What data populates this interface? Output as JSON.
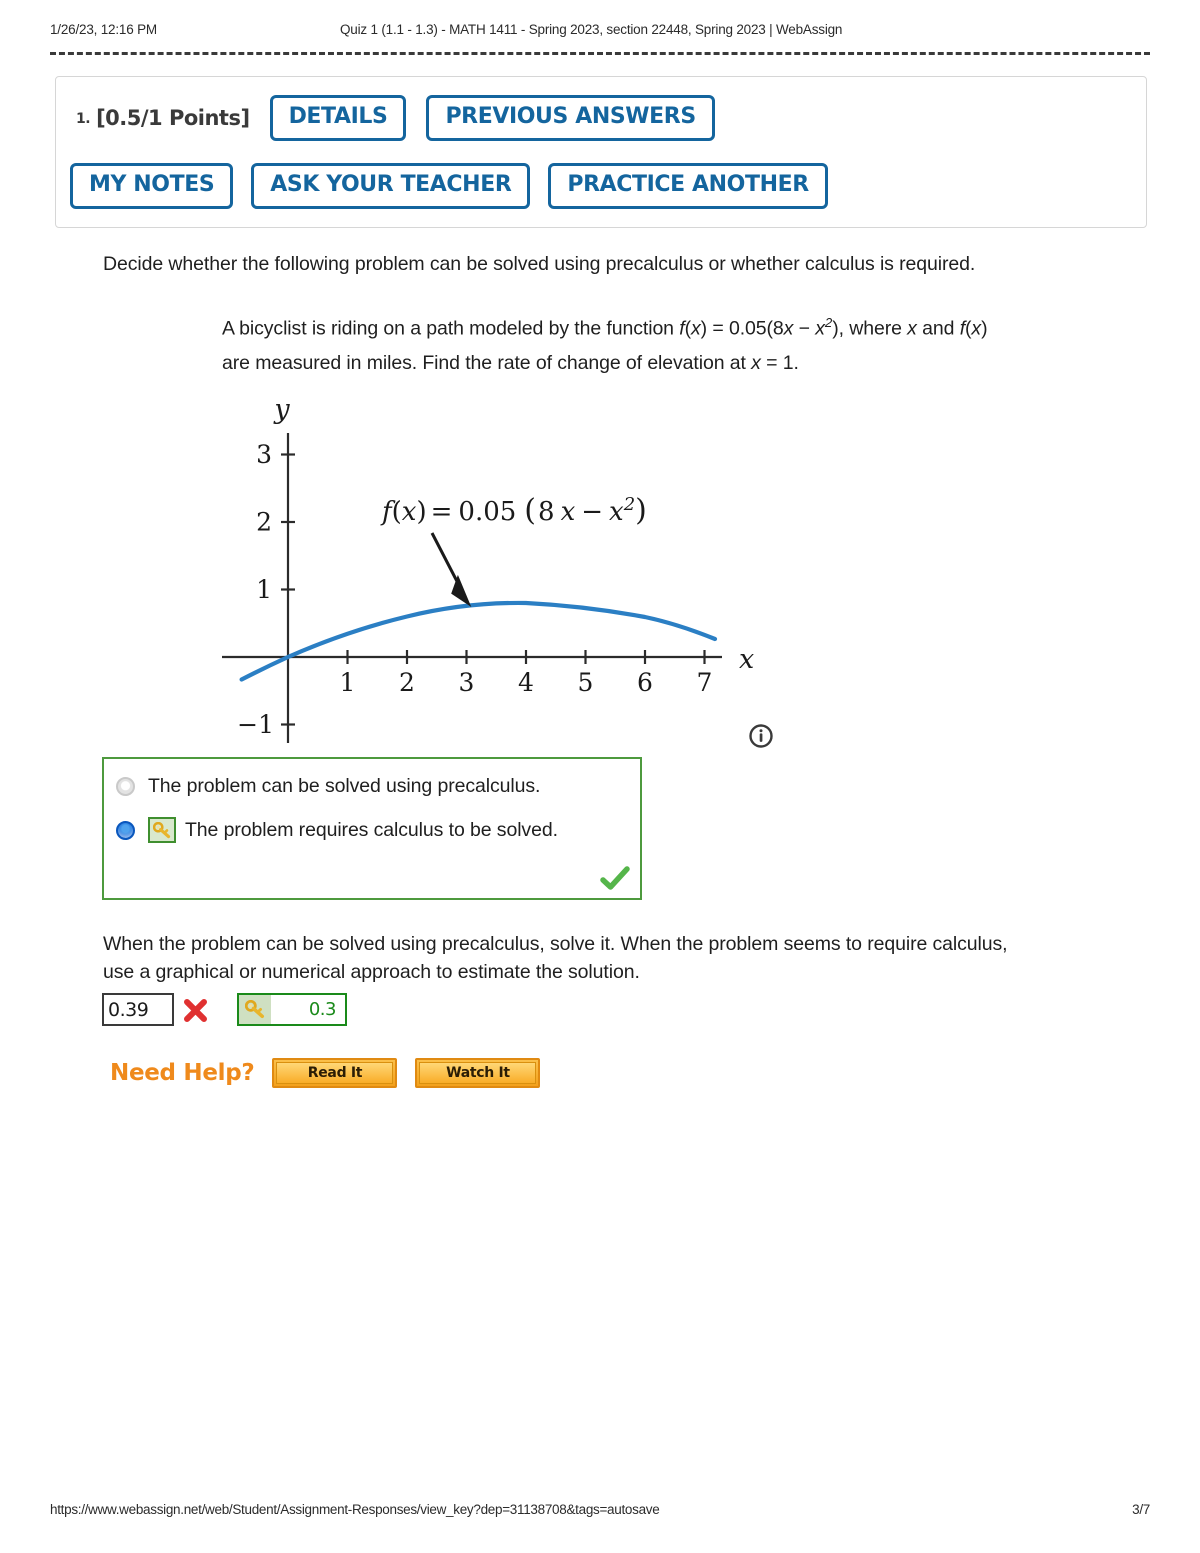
{
  "print_header": {
    "date": "1/26/23, 12:16 PM",
    "title": "Quiz 1 (1.1 - 1.3) - MATH 1411 - Spring 2023, section 22448, Spring 2023 | WebAssign"
  },
  "question": {
    "number": "1.",
    "points": "[0.5/1 Points]",
    "buttons": {
      "details": "DETAILS",
      "previous_answers": "PREVIOUS ANSWERS",
      "my_notes": "MY NOTES",
      "ask_your_teacher": "ASK YOUR TEACHER",
      "practice_another": "PRACTICE ANOTHER"
    },
    "prompt": "Decide whether the following problem can be solved using precalculus or whether calculus is required.",
    "subprompt_line1_a": "A bicyclist is riding on a path modeled by the function ",
    "subprompt_fx": "f",
    "subprompt_line1_b": ") = 0.05(8",
    "subprompt_line1_c": " − ",
    "subprompt_line1_d": "), where ",
    "subprompt_line1_e": " and ",
    "subprompt_line2": "are measured in miles. Find the rate of change of elevation at x = 1."
  },
  "choices": {
    "option1": {
      "label": "The problem can be solved using precalculus.",
      "selected": false
    },
    "option2": {
      "label": "The problem requires calculus to be solved.",
      "selected": true
    },
    "graded_icon": "green-check-icon",
    "key_icon": "key-icon"
  },
  "second_part": {
    "prompt_line1": "When the problem can be solved using precalculus, solve it. When the problem seems to require calculus,",
    "prompt_line2": "use a graphical or numerical approach to estimate the solution.",
    "student_answer": "0.39",
    "student_answer_status": "incorrect",
    "correct_answer": "0.3"
  },
  "need_help": {
    "label": "Need Help?",
    "read_it": "Read It",
    "watch_it": "Watch It"
  },
  "print_footer": {
    "url": "https://www.webassign.net/web/Student/Assignment-Responses/view_key?dep=31138708&tags=autosave",
    "page": "3/7"
  },
  "colors": {
    "button_blue": "#14659e",
    "curve_blue": "#2b7fc4",
    "correct_green": "#4e9a3e",
    "incorrect_red": "#e03131",
    "help_orange": "#ef8a1c"
  },
  "chart_data": {
    "type": "line",
    "title": "",
    "function_label": "f(x) = 0.05 (8 x − x²)",
    "xlabel": "x",
    "ylabel": "y",
    "xlim": [
      -0.75,
      7.6
    ],
    "ylim": [
      -1.4,
      3.4
    ],
    "xticks": [
      1,
      2,
      3,
      4,
      5,
      6,
      7
    ],
    "yticks": [
      -1,
      1,
      2,
      3
    ],
    "grid": false,
    "legend": "none",
    "annotation": {
      "text": "f(x) = 0.05 (8 x − x²)",
      "arrow_to_x": 3.0,
      "arrow_to_y": 0.75
    },
    "series": [
      {
        "name": "f(x) = 0.05(8x - x^2)",
        "color": "#2b7fc4",
        "x": [
          -0.75,
          -0.5,
          -0.25,
          0,
          0.5,
          1,
          1.5,
          2,
          2.5,
          3,
          3.5,
          4,
          4.5,
          5,
          5.5,
          6,
          6.5,
          7,
          7.25
        ],
        "y": [
          -0.328,
          -0.213,
          -0.104,
          0,
          0.188,
          0.35,
          0.488,
          0.6,
          0.688,
          0.75,
          0.788,
          0.8,
          0.788,
          0.75,
          0.688,
          0.6,
          0.488,
          0.35,
          0.272
        ]
      }
    ]
  }
}
